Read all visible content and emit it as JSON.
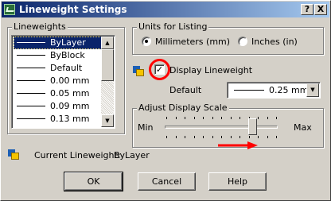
{
  "window": {
    "title": "Lineweight Settings",
    "help_button": "?",
    "close_button": "X"
  },
  "lineweights": {
    "group_label": "Lineweights",
    "items": [
      "ByLayer",
      "ByBlock",
      "Default",
      "0.00 mm",
      "0.05 mm",
      "0.09 mm",
      "0.13 mm"
    ],
    "selected": "ByLayer",
    "scroll_up": "▲",
    "scroll_down": "▼"
  },
  "units": {
    "group_label": "Units for Listing",
    "option_mm": "Millimeters (mm)",
    "option_in": "Inches (in)",
    "selected": "Millimeters (mm)"
  },
  "display_lineweight": {
    "label": "Display Lineweight",
    "checked": true,
    "mark": "✓"
  },
  "default": {
    "label": "Default",
    "value": "0.25 mm",
    "dropdown_arrow": "▼"
  },
  "display_scale": {
    "group_label": "Adjust Display Scale",
    "min_label": "Min",
    "max_label": "Max",
    "value_fraction": 0.81
  },
  "current": {
    "label": "Current Lineweight:",
    "value": "ByLayer"
  },
  "buttons": {
    "ok": "OK",
    "cancel": "Cancel",
    "help": "Help"
  },
  "annotations": {
    "highlight_color": "#ff0000"
  }
}
